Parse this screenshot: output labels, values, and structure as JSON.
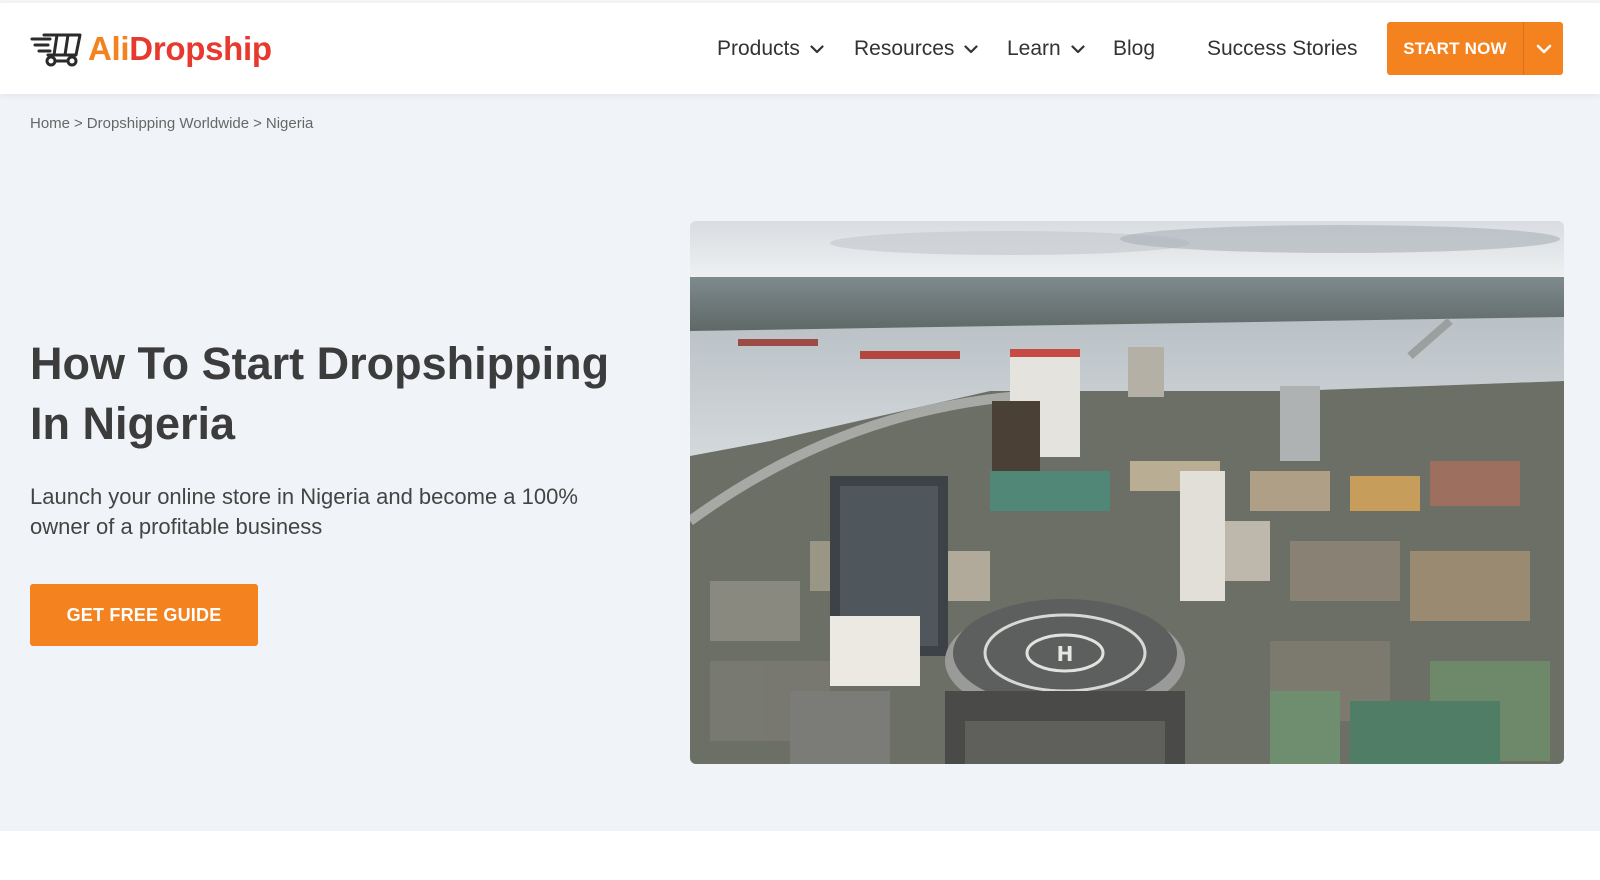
{
  "brand": {
    "name_part1": "Ali",
    "name_part2": "Dropship",
    "colors": {
      "orange": "#f4821f",
      "red": "#e8392e"
    },
    "icon": "shopping-cart-icon"
  },
  "nav": {
    "items": [
      {
        "label": "Products",
        "has_dropdown": true
      },
      {
        "label": "Resources",
        "has_dropdown": true
      },
      {
        "label": "Learn",
        "has_dropdown": true
      },
      {
        "label": "Blog",
        "has_dropdown": false
      },
      {
        "label": "Success Stories",
        "has_dropdown": false
      }
    ],
    "cta_label": "START NOW",
    "cta_icon": "chevron-down-icon"
  },
  "breadcrumb": [
    {
      "label": "Home"
    },
    {
      "label": "Dropshipping Worldwide"
    },
    {
      "label": "Nigeria"
    }
  ],
  "breadcrumb_separator": ">",
  "hero": {
    "title_line1": "How To Start Dropshipping",
    "title_line2": "In Nigeria",
    "subtitle_line1": "Launch your online store in Nigeria and become a 100%",
    "subtitle_line2": "owner of a profitable business",
    "cta_label": "GET FREE GUIDE",
    "image_subject": "aerial-city-photo"
  },
  "theme": {
    "accent": "#f4821f",
    "hero_bg": "#f0f4f8",
    "text_dark": "#3c3c3c"
  }
}
